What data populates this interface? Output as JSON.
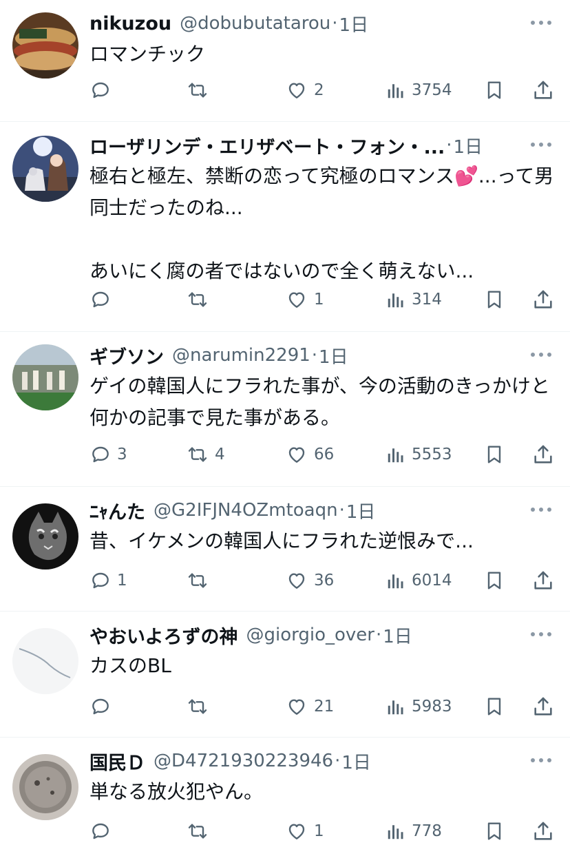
{
  "posts": [
    {
      "name": "nikuzou",
      "handle": "@dobubutatarou",
      "separator": "·",
      "time": "1日",
      "text": "ロマンチック",
      "replies": "",
      "reposts": "",
      "likes": "2",
      "views": "3754",
      "avatar": "burger"
    },
    {
      "name": "ローザリンデ・エリザベート・フォン・...",
      "handle": "",
      "separator": "·",
      "time": "1日",
      "text": "極右と極左、禁断の恋って究極のロマンス💕...って男同士だったのね...\n\nあいにく腐の者ではないので全く萌えない...",
      "replies": "",
      "reposts": "",
      "likes": "1",
      "views": "314",
      "avatar": "anime"
    },
    {
      "name": "ギブソン",
      "handle": "@narumin2291",
      "separator": "·",
      "time": "1日",
      "text": "ゲイの韓国人にフラれた事が、今の活動のきっかけと何かの記事で見た事がある。",
      "replies": "3",
      "reposts": "4",
      "likes": "66",
      "views": "5553",
      "avatar": "crosswalk"
    },
    {
      "name": "ﾆｬんた",
      "handle": "@G2IFJN4OZmtoaqn",
      "separator": "·",
      "time": "1日",
      "text": "昔、イケメンの韓国人にフラれた逆恨みで...",
      "replies": "1",
      "reposts": "",
      "likes": "36",
      "views": "6014",
      "avatar": "cat"
    },
    {
      "name": "やおいよろずの神",
      "handle": "@giorgio_over",
      "separator": "·",
      "time": "1日",
      "text": "カスのBL",
      "replies": "",
      "reposts": "",
      "likes": "21",
      "views": "5983",
      "avatar": "line"
    },
    {
      "name": "国民Ｄ",
      "handle": "@D4721930223946",
      "separator": "·",
      "time": "1日",
      "text": "単なる放火犯やん。",
      "replies": "",
      "reposts": "",
      "likes": "1",
      "views": "778",
      "avatar": "bowl"
    }
  ]
}
